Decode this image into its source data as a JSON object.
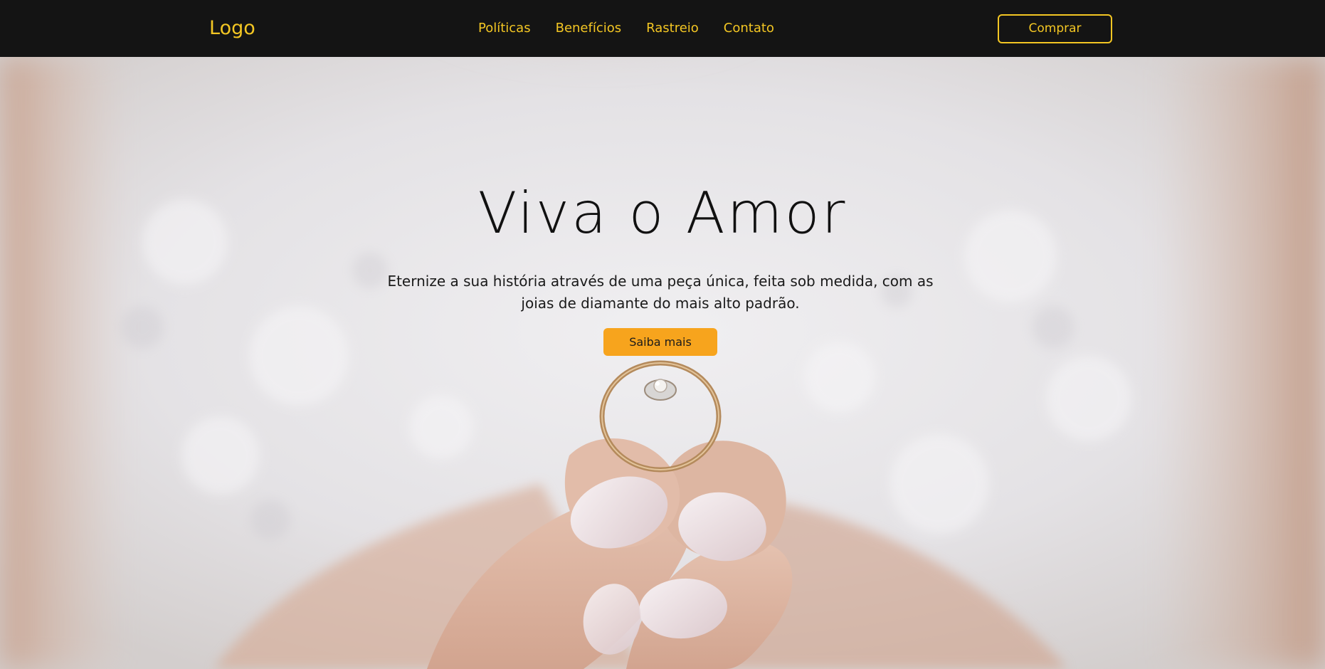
{
  "navbar": {
    "logo": "Logo",
    "links": [
      {
        "label": "Políticas"
      },
      {
        "label": "Benefícios"
      },
      {
        "label": "Rastreio"
      },
      {
        "label": "Contato"
      }
    ],
    "buy_label": "Comprar"
  },
  "hero": {
    "title": "Viva o Amor",
    "subtitle": "Eternize a sua história através de uma peça única, feita sob medida, com as joias de diamante do mais alto padrão.",
    "cta_label": "Saiba mais"
  },
  "colors": {
    "navbar_bg": "#141414",
    "accent_yellow": "#f3c623",
    "cta_orange": "#f7a41d"
  }
}
